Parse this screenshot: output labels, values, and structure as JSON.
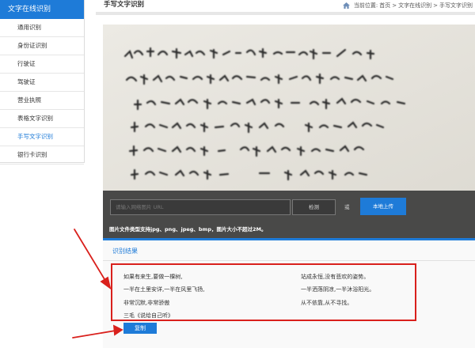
{
  "sidebar": {
    "header": "文字在线识别",
    "items": [
      {
        "label": "通用识别",
        "active": false
      },
      {
        "label": "身份证识别",
        "active": false
      },
      {
        "label": "行驶证",
        "active": false
      },
      {
        "label": "驾驶证",
        "active": false
      },
      {
        "label": "营业执照",
        "active": false
      },
      {
        "label": "表格文字识别",
        "active": false
      },
      {
        "label": "手写文字识别",
        "active": true
      },
      {
        "label": "银行卡识别",
        "active": false
      }
    ]
  },
  "header": {
    "title": "手写文字识别",
    "breadcrumb": {
      "prefix": "当前位置:",
      "items": [
        "首页",
        "文字在线识别",
        "手写文字识别"
      ],
      "separator": ">"
    }
  },
  "upload": {
    "url_placeholder": "请输入网络图片 URL",
    "detect_label": "检测",
    "or_label": "或",
    "upload_label": "本地上传",
    "formats_note": "图片文件类型支持jpg、png、jpeg、bmp，图片大小不超过2M。"
  },
  "results": {
    "title": "识别结果",
    "lines_left": [
      "如果有来生,要做一棵树,",
      "一半在土里安详,一半在风里飞扬,",
      "非常沉默,非常骄傲",
      "三毛《说给自己听》"
    ],
    "lines_right": [
      "站成永恒,没有悲欢的姿势。",
      "一半洒落阴凉,一半沐浴阳光。",
      "从不依靠,从不寻找。"
    ],
    "copy_label": "复制"
  },
  "colors": {
    "accent": "#1e7bd8",
    "annotation": "#d9201c"
  }
}
